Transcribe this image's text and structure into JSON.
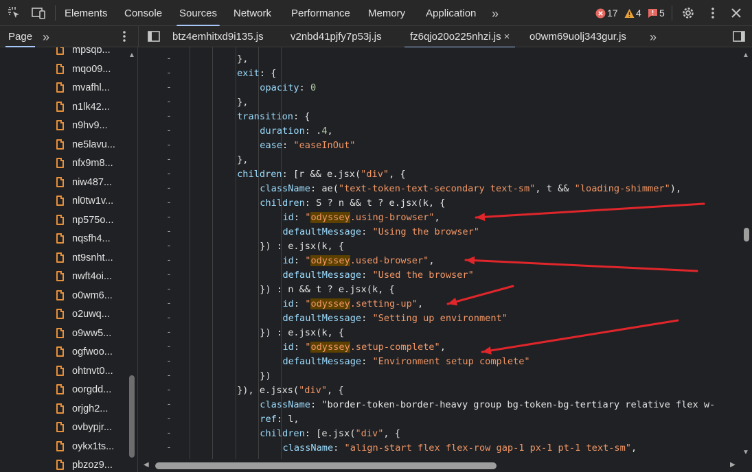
{
  "toolbar": {
    "tabs": [
      "Elements",
      "Console",
      "Sources",
      "Network",
      "Performance",
      "Memory",
      "Application"
    ],
    "active_tab": "Sources",
    "more_tabs": "»",
    "errors": "17",
    "warnings": "4",
    "issues": "5"
  },
  "secondary": {
    "page_tab": "Page",
    "more": "»",
    "file_tabs": [
      "btz4emhitxd9i135.js",
      "v2nbd41pjfy7p53j.js",
      "fz6qjo20o225nhzi.js",
      "o0wm69uolj343gur.js"
    ],
    "active_file": "fz6qjo20o225nhzi.js",
    "close": "×"
  },
  "tree": {
    "items": [
      "mpsqb...",
      "mqo09...",
      "mvafhl...",
      "n1lk42...",
      "n9hv9...",
      "ne5lavu...",
      "nfx9m8...",
      "niw487...",
      "nl0tw1v...",
      "np575o...",
      "nqsfh4...",
      "nt9snht...",
      "nwft4oi...",
      "o0wm6...",
      "o2uwq...",
      "o9ww5...",
      "ogfwoo...",
      "ohtnvt0...",
      "oorgdd...",
      "orjgh2...",
      "ovbypjr...",
      "oykx1ts...",
      "pbzoz9..."
    ]
  },
  "code": {
    "lines": [
      {
        "i": 3,
        "t": "},"
      },
      {
        "i": 3,
        "t": "exit: {"
      },
      {
        "i": 4,
        "t": "opacity: 0"
      },
      {
        "i": 3,
        "t": "},"
      },
      {
        "i": 3,
        "t": "transition: {"
      },
      {
        "i": 4,
        "t": "duration: .4,"
      },
      {
        "i": 4,
        "t": "ease: \"easeInOut\""
      },
      {
        "i": 3,
        "t": "},"
      },
      {
        "i": 3,
        "t": "children: [r && e.jsx(\"div\", {"
      },
      {
        "i": 4,
        "t": "className: ae(\"text-token-text-secondary text-sm\", t && \"loading-shimmer\"),"
      },
      {
        "i": 4,
        "t": "children: S ? n && t ? e.jsx(k, {"
      },
      {
        "i": 5,
        "t": "id: \"odyssey.using-browser\","
      },
      {
        "i": 5,
        "t": "defaultMessage: \"Using the browser\""
      },
      {
        "i": 4,
        "t": "}) : e.jsx(k, {"
      },
      {
        "i": 5,
        "t": "id: \"odyssey.used-browser\","
      },
      {
        "i": 5,
        "t": "defaultMessage: \"Used the browser\""
      },
      {
        "i": 4,
        "t": "}) : n && t ? e.jsx(k, {"
      },
      {
        "i": 5,
        "t": "id: \"odyssey.setting-up\","
      },
      {
        "i": 5,
        "t": "defaultMessage: \"Setting up environment\""
      },
      {
        "i": 4,
        "t": "}) : e.jsx(k, {"
      },
      {
        "i": 5,
        "t": "id: \"odyssey.setup-complete\","
      },
      {
        "i": 5,
        "t": "defaultMessage: \"Environment setup complete\""
      },
      {
        "i": 4,
        "t": "})"
      },
      {
        "i": 3,
        "t": "}), e.jsxs(\"div\", {"
      },
      {
        "i": 4,
        "t": "className: \"border-token-border-heavy group bg-token-bg-tertiary relative flex w-"
      },
      {
        "i": 4,
        "t": "ref: l,"
      },
      {
        "i": 4,
        "t": "children: [e.jsx(\"div\", {"
      },
      {
        "i": 5,
        "t": "className: \"align-start flex flex-row gap-1 px-1 pt-1 text-sm\","
      }
    ],
    "highlight_word": "odyssey"
  },
  "colors": {
    "annotation_arrow": "#e0262b",
    "accent": "#a8c7fa",
    "file_icon": "#e8913a"
  }
}
